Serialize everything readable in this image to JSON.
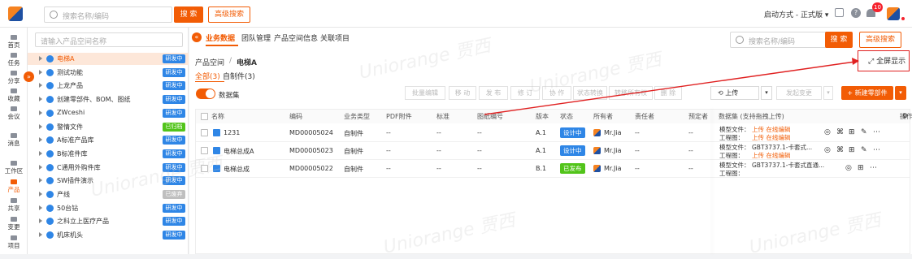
{
  "top": {
    "search_placeholder": "搜索名称/编码",
    "search_btn": "搜 索",
    "adv_search": "高级搜索",
    "launch_mode": "启动方式 - 正式版 ▾",
    "notif_count": "10"
  },
  "nav": [
    {
      "label": "首页"
    },
    {
      "label": "任务"
    },
    {
      "label": "分享"
    },
    {
      "label": "收藏"
    },
    {
      "label": "会议"
    },
    {
      "label": "消息"
    },
    {
      "label": "工作区"
    },
    {
      "label": "产品"
    },
    {
      "label": "共享"
    },
    {
      "label": "变更"
    },
    {
      "label": "项目"
    }
  ],
  "tree": {
    "placeholder": "请输入产品空间名称",
    "items": [
      {
        "label": "电梯A",
        "status": "研发中",
        "color": "#2f86e6"
      },
      {
        "label": "测试功能",
        "status": "研发中",
        "color": "#2f86e6"
      },
      {
        "label": "上龙产品",
        "status": "研发中",
        "color": "#2f86e6"
      },
      {
        "label": "创建零部件、BOM、图纸",
        "status": "研发中",
        "color": "#2f86e6"
      },
      {
        "label": "ZWceshi",
        "status": "研发中",
        "color": "#2f86e6"
      },
      {
        "label": "警情文件",
        "status": "已归档",
        "color": "#52c41a"
      },
      {
        "label": "A标准产品库",
        "status": "研发中",
        "color": "#2f86e6"
      },
      {
        "label": "B标准件库",
        "status": "研发中",
        "color": "#2f86e6"
      },
      {
        "label": "C通用外购件库",
        "status": "研发中",
        "color": "#2f86e6"
      },
      {
        "label": "SW插件演示",
        "status": "研发中",
        "color": "#2f86e6"
      },
      {
        "label": "产线",
        "status": "已废弃",
        "color": "#bfbfbf"
      },
      {
        "label": "50台钻",
        "status": "研发中",
        "color": "#2f86e6"
      },
      {
        "label": "之科立上医疗产品",
        "status": "研发中",
        "color": "#2f86e6"
      },
      {
        "label": "机床机头",
        "status": "研发中",
        "color": "#2f86e6"
      }
    ]
  },
  "main": {
    "tabs": [
      "业务数据",
      "团队管理",
      "产品空间信息",
      "关联项目"
    ],
    "search_placeholder": "搜索名称/编码",
    "search_btn": "搜 索",
    "adv_search": "高级搜索",
    "breadcrumb_root": "产品空间",
    "breadcrumb_sep": "/",
    "breadcrumb_current": "电梯A",
    "fullscreen": "全屏显示",
    "filter_all": "全部(3)",
    "filter_self": "自制件(3)",
    "dataset_label": "数据集",
    "tools": [
      "批量编辑",
      "移 动",
      "发 布",
      "修 订",
      "协 作",
      "状态转换",
      "转移所有权",
      "删 除"
    ],
    "upload": "上传",
    "change": "发起变更",
    "new_part": "+ 新建零部件",
    "columns": [
      "名称",
      "编码",
      "业务类型",
      "PDF附件",
      "标准",
      "图纸编号",
      "版本",
      "状态",
      "所有者",
      "责任者",
      "预定者",
      "数据集 (支持拖拽上传)",
      "操作"
    ],
    "rows": [
      {
        "name": "1231",
        "code": "MD00005024",
        "type": "自制件",
        "pdf": "--",
        "std": "--",
        "draw": "--",
        "ver": "A.1",
        "status": "设计中",
        "status_color": "#2f86e6",
        "owner": "Mr.Jia",
        "resp": "--",
        "reserve": "--",
        "ds1_label": "模型文件：",
        "ds1_val": "上传  在线编辑",
        "ds2_label": "工程图：",
        "ds2_val": "上传  在线编辑"
      },
      {
        "name": "电梯总成A",
        "code": "MD00005023",
        "type": "自制件",
        "pdf": "--",
        "std": "--",
        "draw": "--",
        "ver": "A.1",
        "status": "设计中",
        "status_color": "#2f86e6",
        "owner": "Mr.Jia",
        "resp": "--",
        "reserve": "--",
        "ds1_label": "模型文件：",
        "ds1_val": "GBT3737.1-卡套式...",
        "ds2_label": "工程图：",
        "ds2_val": "上传  在线编辑"
      },
      {
        "name": "电梯总成",
        "code": "MD00005022",
        "type": "自制件",
        "pdf": "--",
        "std": "--",
        "draw": "--",
        "ver": "B.1",
        "status": "已发布",
        "status_color": "#52c41a",
        "owner": "Mr.Jia",
        "resp": "--",
        "reserve": "--",
        "ds1_label": "模型文件：",
        "ds1_val": "GBT3737.1-卡套式直通...",
        "ds2_label": "工程图：",
        "ds2_val": ""
      }
    ]
  },
  "watermark": "Uniorange 贾西",
  "colors": {
    "accent": "#f25c05",
    "brand_blue": "#1e50a2",
    "annotation_red": "#e02020"
  }
}
